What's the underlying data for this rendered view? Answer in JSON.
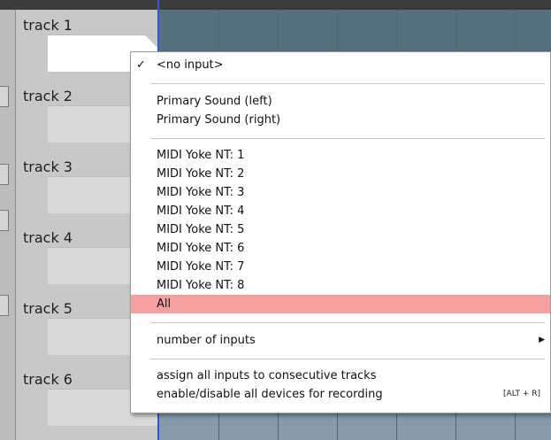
{
  "tracks": [
    "track 1",
    "track 2",
    "track 3",
    "track 4",
    "track 5",
    "track 6"
  ],
  "menu": {
    "no_input": "<no input>",
    "no_input_check": "✓",
    "primary_left": "Primary Sound (left)",
    "primary_right": "Primary Sound (right)",
    "midi": [
      "MIDI Yoke NT:  1",
      "MIDI Yoke NT:  2",
      "MIDI Yoke NT:  3",
      "MIDI Yoke NT:  4",
      "MIDI Yoke NT:  5",
      "MIDI Yoke NT:  6",
      "MIDI Yoke NT:  7",
      "MIDI Yoke NT:  8"
    ],
    "all": "All",
    "number_of_inputs": "number of inputs",
    "assign_consecutive": "assign all inputs to consecutive tracks",
    "enable_disable": "enable/disable all devices for recording",
    "enable_disable_shortcut": "[ALT + R]",
    "highlight_color": "#f59fa1"
  }
}
